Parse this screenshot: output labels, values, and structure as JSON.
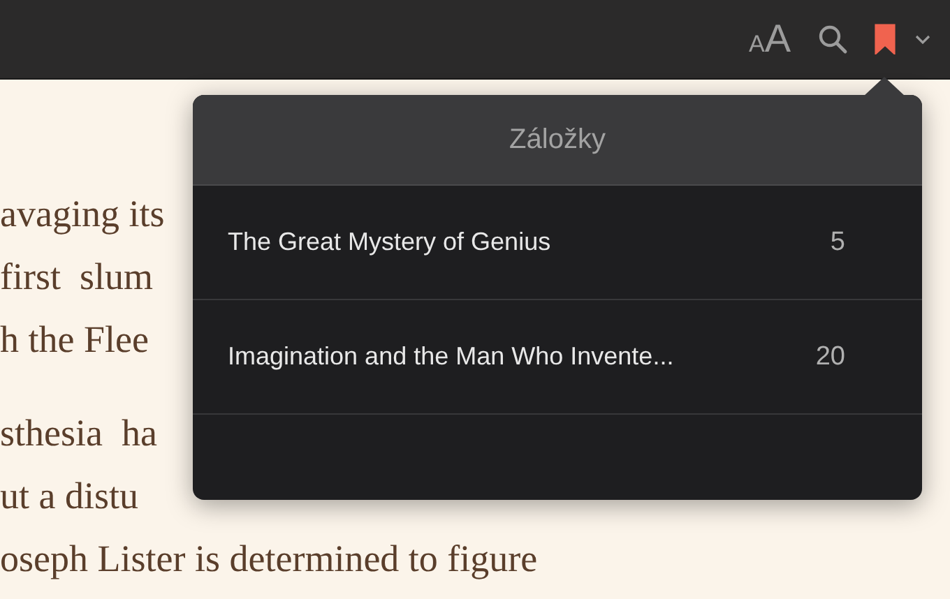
{
  "toolbar": {
    "font_size_button": {
      "small": "A",
      "large": "A"
    },
    "bookmarked": true
  },
  "book": {
    "paragraphs": [
      [
        "avaging its",
        "first  slum",
        "h the Flee"
      ],
      [
        "sthesia  ha",
        "ut a distu",
        "oseph Lister is determined to figure"
      ]
    ]
  },
  "bookmarks_popover": {
    "title": "Záložky",
    "items": [
      {
        "title": "The Great Mystery of Genius",
        "page": "5"
      },
      {
        "title": "Imagination and the Man Who Invente...",
        "page": "20"
      }
    ]
  }
}
